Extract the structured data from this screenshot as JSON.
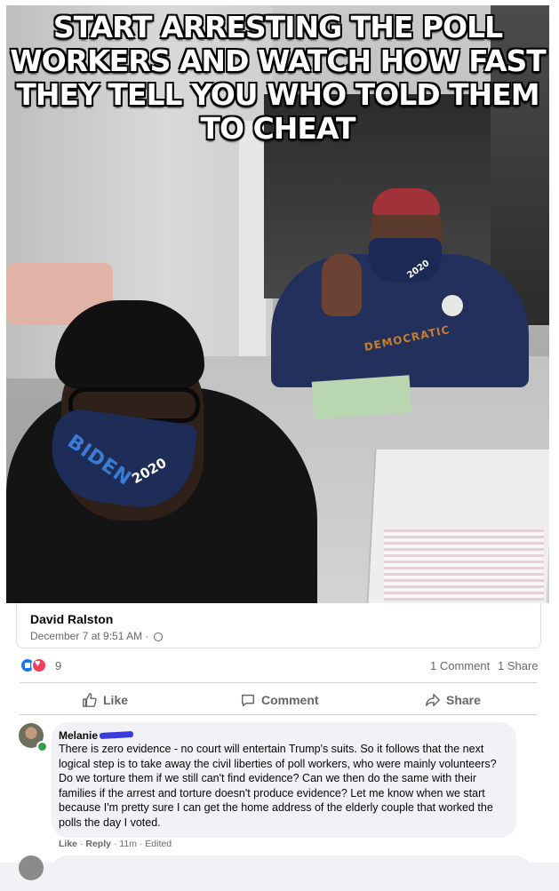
{
  "shared_image": {
    "meme_text": "START ARRESTING THE POLL WORKERS AND WATCH HOW FAST THEY TELL YOU WHO TOLD THEM TO CHEAT",
    "mask_text_front": "BIDEN",
    "mask_year_front": "2020",
    "mask_year_back": "2020",
    "sweatshirt_text": "DEMOCRATIC"
  },
  "author": {
    "name": "David Ralston",
    "time": "December 7 at 9:51 AM ·"
  },
  "reactions": {
    "count": "9",
    "comments": "1 Comment",
    "shares": "1 Share",
    "like_color": "#1877f2",
    "love_color": "#f33e58"
  },
  "actions": {
    "like": "Like",
    "comment": "Comment",
    "share": "Share"
  },
  "comment": {
    "name": "Melanie",
    "text": "There is zero evidence - no court will entertain Trump's suits. So it follows that the next logical step is to take away the civil liberties of poll workers, who were mainly volunteers? Do we torture them if we still can't find evidence? Can we then do the same with their families if the arrest and torture doesn't produce evidence? Let me know when we start because I'm pretty sure I can get the home address of the elderly couple that worked the polls the day I voted.",
    "like": "Like",
    "sep1": " · ",
    "reply": "Reply",
    "sep2": " · ",
    "time": "11m",
    "sep3": " · ",
    "edited": "Edited"
  }
}
